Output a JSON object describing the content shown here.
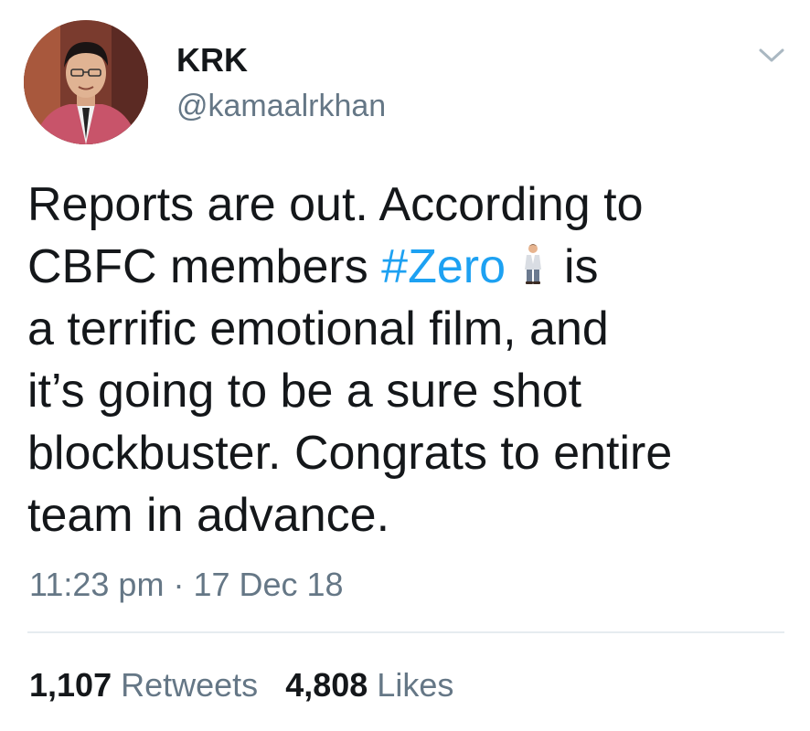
{
  "author": {
    "display_name": "KRK",
    "handle": "@kamaalrkhan"
  },
  "tweet": {
    "line1": "Reports are out. According to",
    "line2_before": "CBFC members ",
    "hashtag": "#Zero",
    "line2_after": "is",
    "line3": "a terrific emotional film, and",
    "line4": "it’s going to be a sure shot",
    "line5": "blockbuster. Congrats to entire",
    "line6": "team in advance.",
    "emoji": "man-in-suit-emoji"
  },
  "meta": {
    "time": "11:23 pm",
    "separator": " · ",
    "date": "17 Dec 18"
  },
  "stats": {
    "retweets_count": "1,107",
    "retweets_label": "Retweets",
    "likes_count": "4,808",
    "likes_label": "Likes"
  },
  "icons": {
    "caret": "chevron-down-icon"
  },
  "colors": {
    "link": "#1da1f2",
    "secondary_text": "#657786",
    "primary_text": "#14171a",
    "divider": "#e6ecf0"
  }
}
